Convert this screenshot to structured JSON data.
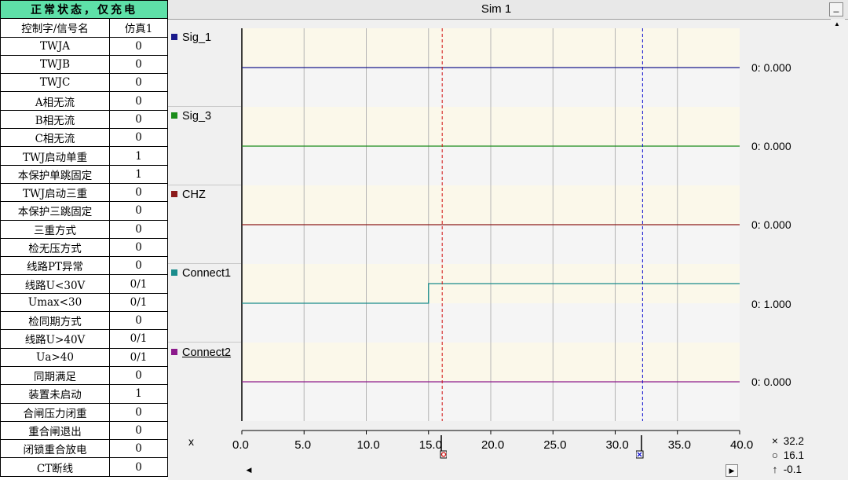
{
  "table": {
    "title": "正常状态，仅充电",
    "header": [
      "控制字/信号名",
      "仿真1"
    ],
    "rows": [
      [
        "TWJA",
        "0"
      ],
      [
        "TWJB",
        "0"
      ],
      [
        "TWJC",
        "0"
      ],
      [
        "A相无流",
        "0"
      ],
      [
        "B相无流",
        "0"
      ],
      [
        "C相无流",
        "0"
      ],
      [
        "TWJ启动单重",
        "1"
      ],
      [
        "本保护单跳固定",
        "1"
      ],
      [
        "TWJ启动三重",
        "0"
      ],
      [
        "本保护三跳固定",
        "0"
      ],
      [
        "三重方式",
        "0"
      ],
      [
        "检无压方式",
        "0"
      ],
      [
        "线路PT异常",
        "0"
      ],
      [
        "线路U<30V",
        "0/1"
      ],
      [
        "Umax<30",
        "0/1"
      ],
      [
        "检同期方式",
        "0"
      ],
      [
        "线路U>40V",
        "0/1"
      ],
      [
        "Ua>40",
        "0/1"
      ],
      [
        "同期满足",
        "0"
      ],
      [
        "装置未启动",
        "1"
      ],
      [
        "合闸压力闭重",
        "0"
      ],
      [
        "重合闸退出",
        "0"
      ],
      [
        "闭锁重合放电",
        "0"
      ],
      [
        "CT断线",
        "0"
      ]
    ]
  },
  "sim": {
    "title": "Sim 1",
    "minimize_label": "_",
    "signals": [
      {
        "name": "Sig_1",
        "color": "#1a1a8c",
        "readout": "0: 0.000"
      },
      {
        "name": "Sig_3",
        "color": "#1a8c1a",
        "readout": "0: 0.000"
      },
      {
        "name": "CHZ",
        "color": "#8c1a1a",
        "readout": "0: 0.000"
      },
      {
        "name": "Connect1",
        "color": "#1a8c8c",
        "readout": "0: 1.000"
      },
      {
        "name": "Connect2",
        "color": "#8c1a8c",
        "readout": "0: 0.000"
      }
    ],
    "x_axis_label": "x",
    "ticks": [
      "0.0",
      "5.0",
      "10.0",
      "15.0",
      "20.0",
      "25.0",
      "30.0",
      "35.0",
      "40.0"
    ],
    "cursor_readouts": [
      {
        "symbol": "×",
        "value": "32.2"
      },
      {
        "symbol": "○",
        "value": "16.1"
      },
      {
        "symbol": "↑",
        "value": "-0.1"
      }
    ],
    "scroll_left": "◀",
    "scroll_right": "▶",
    "scroll_up": "▲"
  },
  "chart_data": {
    "type": "line",
    "xlim": [
      0,
      40
    ],
    "cursors": [
      {
        "x": 16.1,
        "color": "#d01010"
      },
      {
        "x": 32.2,
        "color": "#1010d0"
      }
    ],
    "series": [
      {
        "name": "Sig_1",
        "x": [
          0,
          40
        ],
        "y": [
          0,
          0
        ]
      },
      {
        "name": "Sig_3",
        "x": [
          0,
          40
        ],
        "y": [
          0,
          0
        ]
      },
      {
        "name": "CHZ",
        "x": [
          0,
          40
        ],
        "y": [
          0,
          0
        ]
      },
      {
        "name": "Connect1",
        "x": [
          0,
          15.0,
          15.0,
          40
        ],
        "y": [
          0,
          0,
          1,
          1
        ]
      },
      {
        "name": "Connect2",
        "x": [
          0,
          40
        ],
        "y": [
          0,
          0
        ]
      }
    ]
  }
}
